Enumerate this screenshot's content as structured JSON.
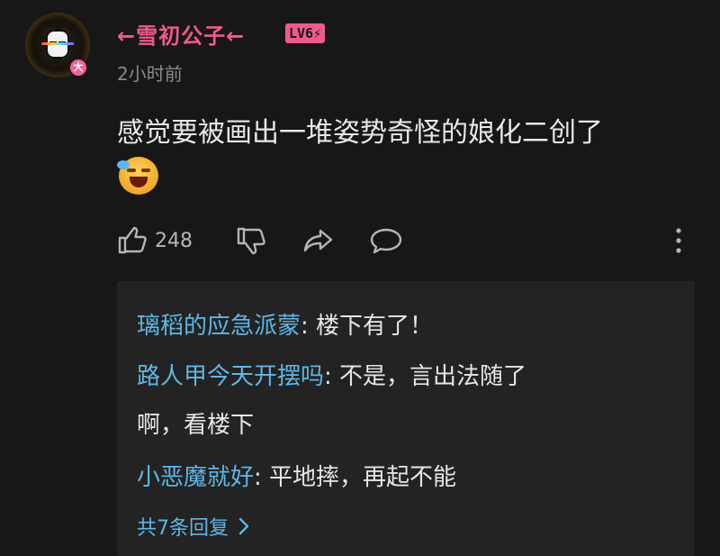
{
  "comment": {
    "username": "←雪初公子←",
    "level": "LV6⚡",
    "avatar_badge": "大",
    "timestamp": "2小时前",
    "text": "感觉要被画出一堆姿势奇怪的娘化二创了",
    "emoji": "laughing-crying-emoji"
  },
  "actions": {
    "like_count": "248",
    "icons": [
      "thumbs-up-icon",
      "thumbs-down-icon",
      "share-icon",
      "reply-icon",
      "more-vertical-icon"
    ]
  },
  "replies": {
    "items": [
      {
        "author": "璃稻的应急派蒙",
        "text": ": 楼下有了！"
      },
      {
        "author": "路人甲今天开摆吗",
        "text": ": 不是，言出法随了",
        "text2": "啊，看楼下"
      },
      {
        "author": "小恶魔就好",
        "text": ": 平地摔，再起不能"
      }
    ],
    "more_label": "共7条回复"
  },
  "colors": {
    "background": "#171717",
    "username": "#ef5a8e",
    "reply_author": "#5fb6e6",
    "reply_panel": "#232323"
  }
}
